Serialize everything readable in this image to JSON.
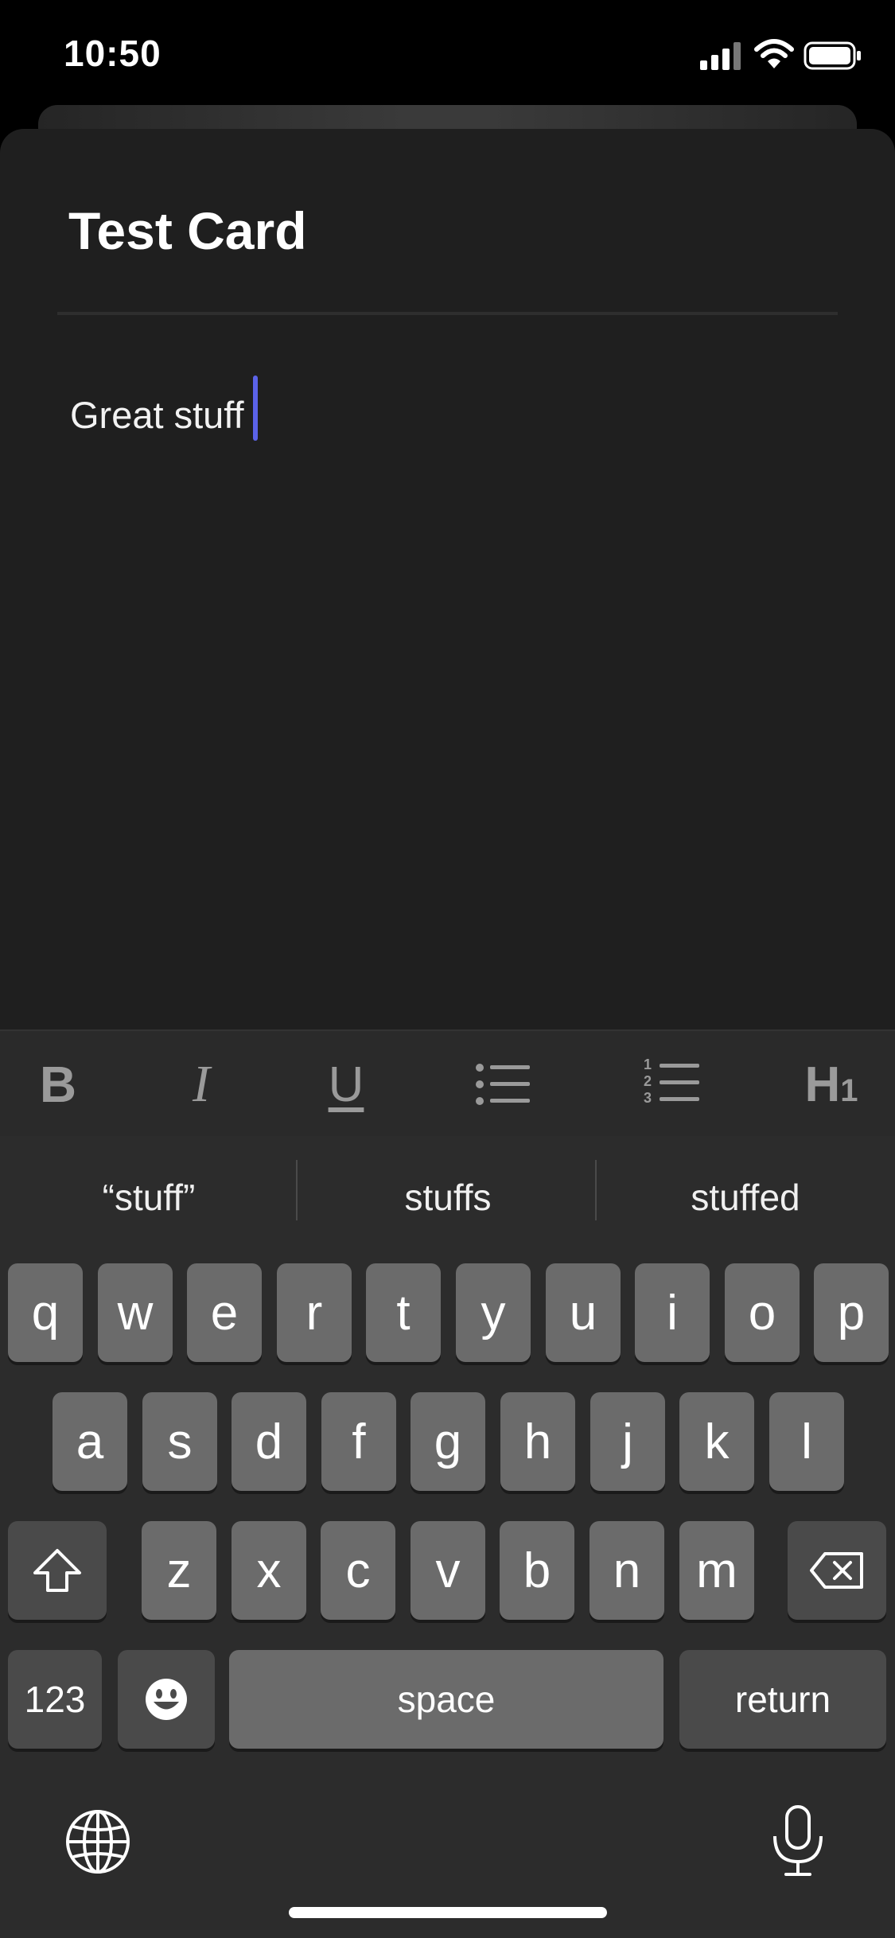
{
  "status_bar": {
    "time": "10:50"
  },
  "card": {
    "title": "Test Card",
    "body": "Great stuff"
  },
  "toolbar": {
    "bold": "B",
    "italic": "I",
    "underline": "U",
    "heading_main": "H",
    "heading_sub": "1",
    "numbered_list_digits": [
      "1",
      "2",
      "3"
    ]
  },
  "suggestions": [
    "“stuff”",
    "stuffs",
    "stuffed"
  ],
  "keyboard": {
    "row1": [
      "q",
      "w",
      "e",
      "r",
      "t",
      "y",
      "u",
      "i",
      "o",
      "p"
    ],
    "row2": [
      "a",
      "s",
      "d",
      "f",
      "g",
      "h",
      "j",
      "k",
      "l"
    ],
    "row3": [
      "z",
      "x",
      "c",
      "v",
      "b",
      "n",
      "m"
    ],
    "numbers_label": "123",
    "space_label": "space",
    "return_label": "return"
  },
  "icons": {
    "signal": "cellular-signal-icon",
    "wifi": "wifi-icon",
    "battery": "battery-icon",
    "shift": "shift-icon",
    "delete": "delete-icon",
    "emoji": "emoji-icon",
    "globe": "globe-icon",
    "mic": "microphone-icon"
  },
  "colors": {
    "cursor": "#5b63e8",
    "card_bg": "#1f1f1f",
    "key_bg": "#6b6b6b"
  }
}
